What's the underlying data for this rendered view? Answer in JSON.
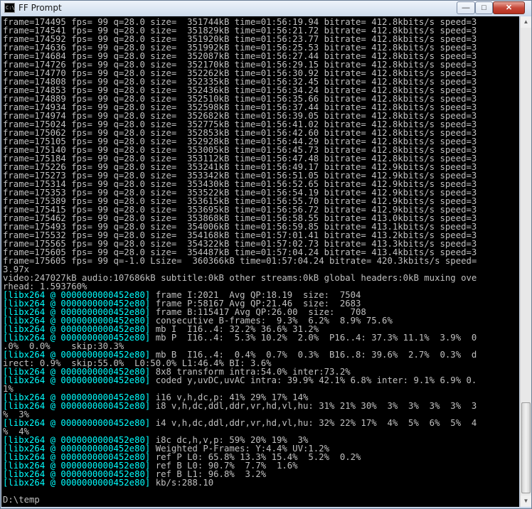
{
  "window": {
    "title": "FF Prompt",
    "icon_text": "C:\\",
    "controls": {
      "minimize": "—",
      "maximize": "□",
      "close": "✕"
    }
  },
  "console": {
    "lines": [
      {
        "text": "frame=174495 fps= 99 q=28.0 size=  351744kB time=01:56:19.94 bitrate= 412.8kbits/s speed=3"
      },
      {
        "text": "frame=174541 fps= 99 q=28.0 size=  351829kB time=01:56:21.72 bitrate= 412.8kbits/s speed=3"
      },
      {
        "text": "frame=174592 fps= 99 q=28.0 size=  351920kB time=01:56:23.77 bitrate= 412.8kbits/s speed=3"
      },
      {
        "text": "frame=174636 fps= 99 q=28.0 size=  351992kB time=01:56:25.53 bitrate= 412.8kbits/s speed=3"
      },
      {
        "text": "frame=174684 fps= 99 q=28.0 size=  352087kB time=01:56:27.44 bitrate= 412.8kbits/s speed=3"
      },
      {
        "text": "frame=174726 fps= 99 q=28.0 size=  352170kB time=01:56:29.15 bitrate= 412.8kbits/s speed=3"
      },
      {
        "text": "frame=174770 fps= 99 q=28.0 size=  352262kB time=01:56:30.92 bitrate= 412.8kbits/s speed=3"
      },
      {
        "text": "frame=174808 fps= 99 q=28.0 size=  352335kB time=01:56:32.45 bitrate= 412.8kbits/s speed=3"
      },
      {
        "text": "frame=174853 fps= 99 q=28.0 size=  352436kB time=01:56:34.24 bitrate= 412.8kbits/s speed=3"
      },
      {
        "text": "frame=174889 fps= 99 q=28.0 size=  352510kB time=01:56:35.66 bitrate= 412.8kbits/s speed=3"
      },
      {
        "text": "frame=174934 fps= 99 q=28.0 size=  352598kB time=01:56:37.44 bitrate= 412.8kbits/s speed=3"
      },
      {
        "text": "frame=174974 fps= 99 q=28.0 size=  352682kB time=01:56:39.05 bitrate= 412.8kbits/s speed=3"
      },
      {
        "text": "frame=175024 fps= 99 q=28.0 size=  352775kB time=01:56:41.02 bitrate= 412.8kbits/s speed=3"
      },
      {
        "text": "frame=175062 fps= 99 q=28.0 size=  352853kB time=01:56:42.60 bitrate= 412.8kbits/s speed=3"
      },
      {
        "text": "frame=175105 fps= 99 q=28.0 size=  352928kB time=01:56:44.29 bitrate= 412.8kbits/s speed=3"
      },
      {
        "text": "frame=175140 fps= 99 q=28.0 size=  353005kB time=01:56:45.73 bitrate= 412.8kbits/s speed=3"
      },
      {
        "text": "frame=175184 fps= 99 q=28.0 size=  353112kB time=01:56:47.48 bitrate= 412.8kbits/s speed=3"
      },
      {
        "text": "frame=175226 fps= 99 q=28.0 size=  353241kB time=01:56:49.17 bitrate= 412.9kbits/s speed=3"
      },
      {
        "text": "frame=175273 fps= 99 q=28.0 size=  353342kB time=01:56:51.05 bitrate= 412.9kbits/s speed=3"
      },
      {
        "text": "frame=175314 fps= 99 q=28.0 size=  353430kB time=01:56:52.65 bitrate= 412.9kbits/s speed=3"
      },
      {
        "text": "frame=175353 fps= 99 q=28.0 size=  353522kB time=01:56:54.19 bitrate= 412.9kbits/s speed=3"
      },
      {
        "text": "frame=175389 fps= 99 q=28.0 size=  353615kB time=01:56:55.70 bitrate= 412.9kbits/s speed=3"
      },
      {
        "text": "frame=175415 fps= 99 q=28.0 size=  353695kB time=01:56:56.72 bitrate= 412.9kbits/s speed=3"
      },
      {
        "text": "frame=175462 fps= 99 q=28.0 size=  353868kB time=01:56:58.55 bitrate= 413.0kbits/s speed=3"
      },
      {
        "text": "frame=175493 fps= 99 q=28.0 size=  354006kB time=01:56:59.85 bitrate= 413.1kbits/s speed=3"
      },
      {
        "text": "frame=175532 fps= 99 q=28.0 size=  354168kB time=01:57:01.41 bitrate= 413.2kbits/s speed=3"
      },
      {
        "text": "frame=175565 fps= 99 q=28.0 size=  354322kB time=01:57:02.73 bitrate= 413.3kbits/s speed=3"
      },
      {
        "text": "frame=175605 fps= 99 q=28.0 size=  354487kB time=01:57:04.24 bitrate= 413.4kbits/s speed=3"
      },
      {
        "text": "frame=175605 fps= 99 q=-1.0 Lsize=  360366kB time=01:57:04.24 bitrate= 420.3kbits/s speed="
      },
      {
        "text": "3.97x"
      },
      {
        "text": "video:247027kB audio:107686kB subtitle:0kB other streams:0kB global headers:0kB muxing ove"
      },
      {
        "text": "rhead: 1.593760%"
      },
      {
        "tag": "[libx264 @ 0000000000452e80]",
        "text": " frame I:2021  Avg QP:18.19  size:  7504"
      },
      {
        "tag": "[libx264 @ 0000000000452e80]",
        "text": " frame P:58167 Avg QP:21.46  size:  2683"
      },
      {
        "tag": "[libx264 @ 0000000000452e80]",
        "text": " frame B:115417 Avg QP:26.00  size:   708"
      },
      {
        "tag": "[libx264 @ 0000000000452e80]",
        "text": " consecutive B-frames:  9.3%  6.2%  8.9% 75.6%"
      },
      {
        "tag": "[libx264 @ 0000000000452e80]",
        "text": " mb I  I16..4: 32.2% 36.6% 31.2%"
      },
      {
        "tag": "[libx264 @ 0000000000452e80]",
        "text": " mb P  I16..4:  5.3% 10.2%  2.0%  P16..4: 37.3% 11.1%  3.9%  0"
      },
      {
        "text": ".0%  0.0%    skip:30.3%"
      },
      {
        "tag": "[libx264 @ 0000000000452e80]",
        "text": " mb B  I16..4:  0.4%  0.7%  0.3%  B16..8: 39.6%  2.7%  0.3%  d"
      },
      {
        "text": "irect: 0.9%  skip:55.0%  L0:50.0% L1:46.4% BI: 3.6%"
      },
      {
        "tag": "[libx264 @ 0000000000452e80]",
        "text": " 8x8 transform intra:54.0% inter:73.2%"
      },
      {
        "tag": "[libx264 @ 0000000000452e80]",
        "text": " coded y,uvDC,uvAC intra: 39.9% 42.1% 6.8% inter: 9.1% 6.9% 0."
      },
      {
        "text": "1%"
      },
      {
        "tag": "[libx264 @ 0000000000452e80]",
        "text": " i16 v,h,dc,p: 41% 29% 17% 14%"
      },
      {
        "tag": "[libx264 @ 0000000000452e80]",
        "text": " i8 v,h,dc,ddl,ddr,vr,hd,vl,hu: 31% 21% 30%  3%  3%  3%  3%  3"
      },
      {
        "text": "%  3%"
      },
      {
        "tag": "[libx264 @ 0000000000452e80]",
        "text": " i4 v,h,dc,ddl,ddr,vr,hd,vl,hu: 32% 22% 17%  4%  5%  6%  5%  4"
      },
      {
        "text": "%  4%"
      },
      {
        "tag": "[libx264 @ 0000000000452e80]",
        "text": " i8c dc,h,v,p: 59% 20% 19%  3%"
      },
      {
        "tag": "[libx264 @ 0000000000452e80]",
        "text": " Weighted P-Frames: Y:4.4% UV:1.2%"
      },
      {
        "tag": "[libx264 @ 0000000000452e80]",
        "text": " ref P L0: 65.8% 13.3% 15.4%  5.2%  0.2%"
      },
      {
        "tag": "[libx264 @ 0000000000452e80]",
        "text": " ref B L0: 90.7%  7.7%  1.6%"
      },
      {
        "tag": "[libx264 @ 0000000000452e80]",
        "text": " ref B L1: 96.8%  3.2%"
      },
      {
        "tag": "[libx264 @ 0000000000452e80]",
        "text": " kb/s:288.10"
      },
      {
        "text": ""
      },
      {
        "text": "D:\\temp"
      }
    ]
  },
  "scrollbar": {
    "up_arrow": "▲",
    "down_arrow": "▼"
  }
}
